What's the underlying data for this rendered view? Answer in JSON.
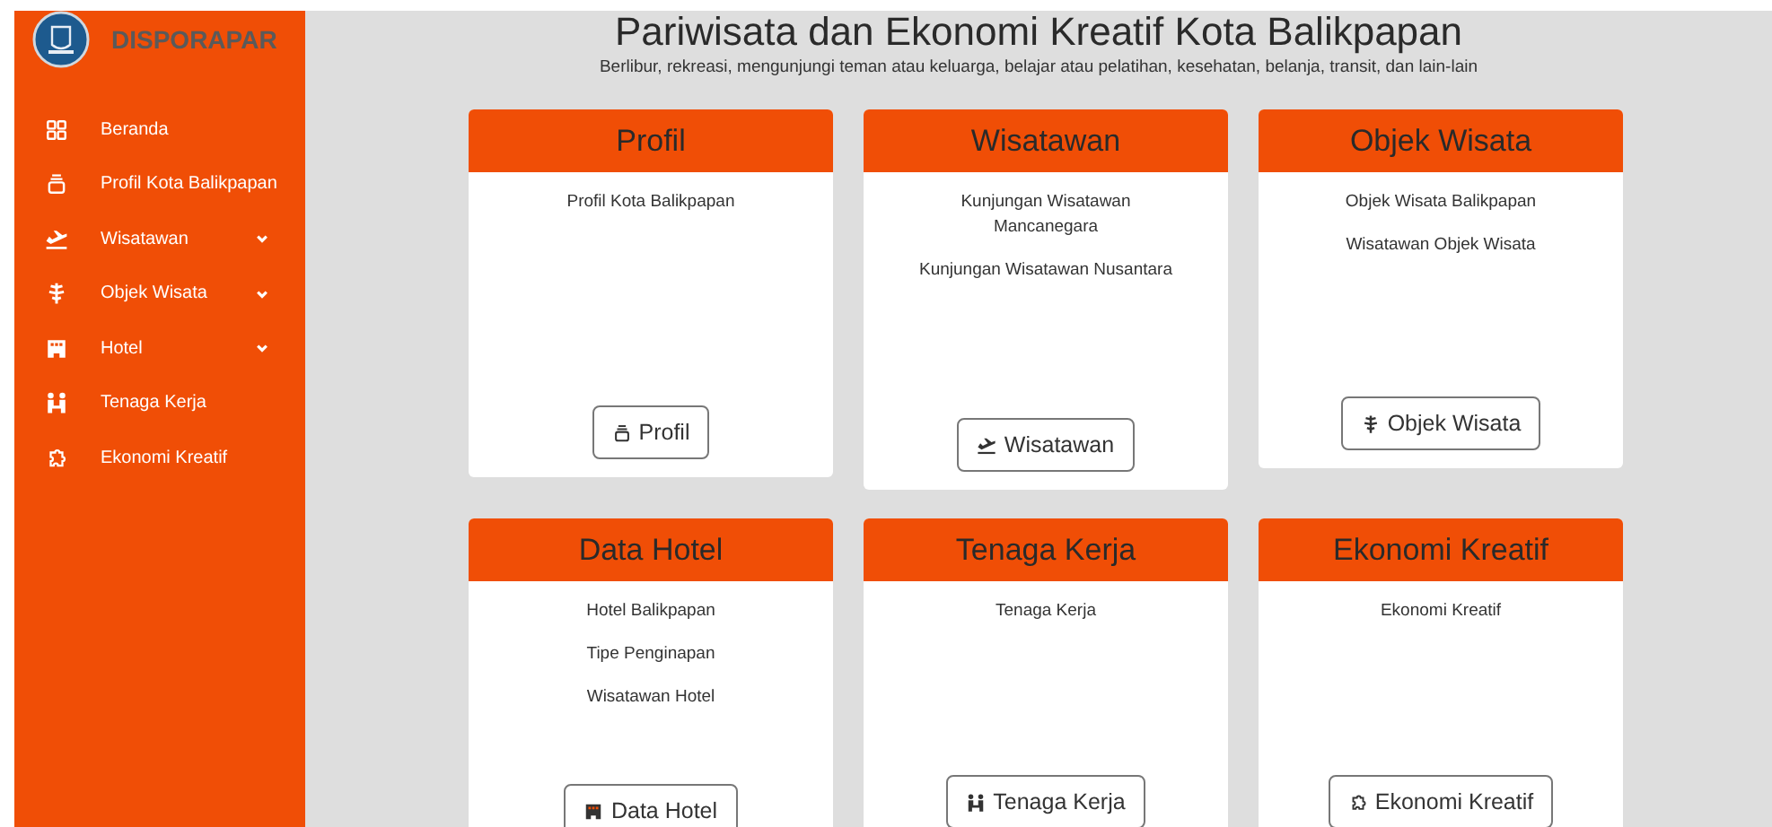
{
  "sidebar": {
    "brand": "DISPORAPAR",
    "items": [
      {
        "label": "Beranda",
        "expandable": false
      },
      {
        "label": "Profil Kota Balikpapan",
        "expandable": false
      },
      {
        "label": "Wisatawan",
        "expandable": true
      },
      {
        "label": "Objek Wisata",
        "expandable": true
      },
      {
        "label": "Hotel",
        "expandable": true
      },
      {
        "label": "Tenaga Kerja",
        "expandable": false
      },
      {
        "label": "Ekonomi Kreatif",
        "expandable": false
      }
    ]
  },
  "header": {
    "title": "Pariwisata dan Ekonomi Kreatif Kota Balikpapan",
    "subtitle": "Berlibur, rekreasi, mengunjungi teman atau keluarga, belajar atau pelatihan, kesehatan, belanja, transit, dan lain-lain"
  },
  "cards": [
    {
      "title": "Profil",
      "links": [
        "Profil Kota Balikpapan"
      ],
      "button": "Profil"
    },
    {
      "title": "Wisatawan",
      "links": [
        "Kunjungan Wisatawan Mancanegara",
        "Kunjungan Wisatawan Nusantara"
      ],
      "button": "Wisatawan"
    },
    {
      "title": "Objek Wisata",
      "links": [
        "Objek Wisata Balikpapan",
        "Wisatawan Objek Wisata"
      ],
      "button": "Objek Wisata"
    },
    {
      "title": "Data Hotel",
      "links": [
        "Hotel Balikpapan",
        "Tipe Penginapan",
        "Wisatawan Hotel"
      ],
      "button": "Data Hotel"
    },
    {
      "title": "Tenaga Kerja",
      "links": [
        "Tenaga Kerja"
      ],
      "button": "Tenaga Kerja"
    },
    {
      "title": "Ekonomi Kreatif",
      "links": [
        "Ekonomi Kreatif"
      ],
      "button": "Ekonomi Kreatif"
    }
  ]
}
